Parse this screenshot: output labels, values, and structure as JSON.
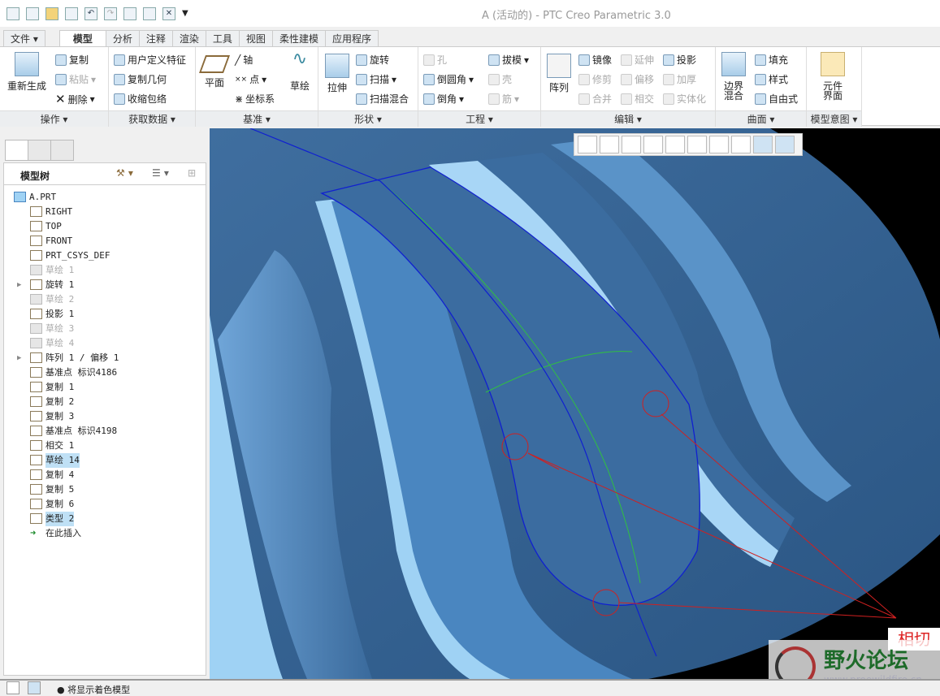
{
  "window": {
    "title": "A (活动的) - PTC Creo Parametric 3.0"
  },
  "quick_access": [
    "app-icon",
    "new-icon",
    "open-icon",
    "save-icon",
    "undo-icon",
    "redo-icon",
    "regenerate-icon",
    "windows-icon",
    "close-icon",
    "customize-icon"
  ],
  "tabs": [
    {
      "label": "文件 ▾"
    },
    {
      "label": "模型",
      "active": true
    },
    {
      "label": "分析"
    },
    {
      "label": "注释"
    },
    {
      "label": "渲染"
    },
    {
      "label": "工具"
    },
    {
      "label": "视图"
    },
    {
      "label": "柔性建模"
    },
    {
      "label": "应用程序"
    }
  ],
  "ribbon": {
    "operations": {
      "label": "操作 ▾",
      "regenerate": "重新生成",
      "copy": "复制",
      "paste": "粘贴",
      "delete": "删除"
    },
    "get_data": {
      "label": "获取数据 ▾",
      "udf": "用户定义特征",
      "copy_geom": "复制几何",
      "shrinkwrap": "收缩包络"
    },
    "datum": {
      "label": "基准 ▾",
      "plane": "平面",
      "axis": "轴",
      "point": "点",
      "csys": "坐标系",
      "sketch": "草绘"
    },
    "shapes": {
      "label": "形状 ▾",
      "extrude": "拉伸",
      "revolve": "旋转",
      "sweep": "扫描",
      "swept_blend": "扫描混合"
    },
    "engineering": {
      "label": "工程 ▾",
      "hole": "孔",
      "round": "倒圆角",
      "chamfer": "倒角",
      "draft": "拔模",
      "shell": "壳",
      "rib": "筋"
    },
    "editing": {
      "label": "编辑 ▾",
      "pattern": "阵列",
      "mirror": "镜像",
      "trim": "修剪",
      "merge": "合并",
      "extend": "延伸",
      "offset": "偏移",
      "intersect": "相交",
      "project": "投影",
      "thicken": "加厚",
      "solidify": "实体化"
    },
    "surfaces": {
      "label": "曲面 ▾",
      "boundary_blend": "边界混合",
      "fill": "填充",
      "style": "样式",
      "freestyle": "自由式"
    },
    "model_intent": {
      "label": "模型意图 ▾",
      "component_interface": "元件界面"
    }
  },
  "model_tree": {
    "title": "模型树",
    "items": [
      {
        "label": "A.PRT",
        "icon": "part-icon"
      },
      {
        "label": "RIGHT",
        "icon": "datum-plane-icon"
      },
      {
        "label": "TOP",
        "icon": "datum-plane-icon"
      },
      {
        "label": "FRONT",
        "icon": "datum-plane-icon"
      },
      {
        "label": "PRT_CSYS_DEF",
        "icon": "csys-icon"
      },
      {
        "label": "草绘 1",
        "icon": "sketch-icon",
        "dim": true
      },
      {
        "label": "旋转 1",
        "icon": "revolve-icon",
        "expandable": true
      },
      {
        "label": "草绘 2",
        "icon": "sketch-icon",
        "dim": true
      },
      {
        "label": "投影 1",
        "icon": "project-icon"
      },
      {
        "label": "草绘 3",
        "icon": "sketch-icon",
        "dim": true
      },
      {
        "label": "草绘 4",
        "icon": "sketch-icon",
        "dim": true
      },
      {
        "label": "阵列 1 / 偏移 1",
        "icon": "pattern-icon",
        "expandable": true
      },
      {
        "label": "基准点 标识4186",
        "icon": "datum-point-icon"
      },
      {
        "label": "复制 1",
        "icon": "copy-surface-icon"
      },
      {
        "label": "复制 2",
        "icon": "copy-surface-icon"
      },
      {
        "label": "复制 3",
        "icon": "copy-surface-icon"
      },
      {
        "label": "基准点 标识4198",
        "icon": "datum-point-icon"
      },
      {
        "label": "相交 1",
        "icon": "intersect-icon"
      },
      {
        "label": "草绘 14",
        "icon": "sketch-icon",
        "selected": true
      },
      {
        "label": "复制 4",
        "icon": "copy-surface-icon"
      },
      {
        "label": "复制 5",
        "icon": "copy-surface-icon"
      },
      {
        "label": "复制 6",
        "icon": "copy-surface-icon"
      },
      {
        "label": "类型 2",
        "icon": "boundary-surface-icon",
        "selected": true
      },
      {
        "label": "在此插入",
        "icon": "insert-here-arrow-icon"
      }
    ]
  },
  "viewport": {
    "annotation": "相切",
    "colors": {
      "model": "#4a7aab",
      "curve_blue": "#1020d0",
      "curve_green": "#30c040",
      "annotation_red": "#d02020"
    }
  },
  "watermark": {
    "title": "野火论坛",
    "url": "www.proewildfire.cn"
  },
  "status": {
    "message": "将显示着色模型"
  }
}
